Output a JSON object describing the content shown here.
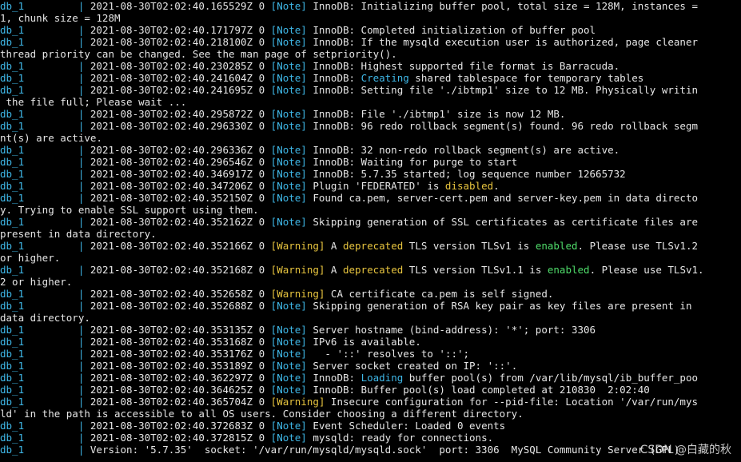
{
  "colors": {
    "background": "#000000",
    "text": "#e6e6e6",
    "service": "#3fb8e8",
    "note": "#3fb8e8",
    "warning": "#e8c53f",
    "highlight_blue": "#3fb8e8",
    "highlight_yellow": "#e8c53f",
    "highlight_green": "#4fdc6a"
  },
  "watermark": "CSDN @白藏的秋",
  "lines": [
    [
      {
        "t": "db_1         | ",
        "c": "svc"
      },
      {
        "t": "2021-08-30T02:02:40.165529Z 0 "
      },
      {
        "t": "[Note]",
        "c": "note"
      },
      {
        "t": " InnoDB: Initializing buffer pool, total size = 128M, instances ="
      }
    ],
    [
      {
        "t": "1, chunk size = 128M"
      }
    ],
    [
      {
        "t": "db_1         | ",
        "c": "svc"
      },
      {
        "t": "2021-08-30T02:02:40.171797Z 0 "
      },
      {
        "t": "[Note]",
        "c": "note"
      },
      {
        "t": " InnoDB: Completed initialization of buffer pool"
      }
    ],
    [
      {
        "t": "db_1         | ",
        "c": "svc"
      },
      {
        "t": "2021-08-30T02:02:40.218100Z 0 "
      },
      {
        "t": "[Note]",
        "c": "note"
      },
      {
        "t": " InnoDB: If the mysqld execution user is authorized, page cleaner"
      }
    ],
    [
      {
        "t": "thread priority can be changed. See the man page of setpriority()."
      }
    ],
    [
      {
        "t": "db_1         | ",
        "c": "svc"
      },
      {
        "t": "2021-08-30T02:02:40.230285Z 0 "
      },
      {
        "t": "[Note]",
        "c": "note"
      },
      {
        "t": " InnoDB: Highest supported file format is Barracuda."
      }
    ],
    [
      {
        "t": "db_1         | ",
        "c": "svc"
      },
      {
        "t": "2021-08-30T02:02:40.241604Z 0 "
      },
      {
        "t": "[Note]",
        "c": "note"
      },
      {
        "t": " InnoDB: "
      },
      {
        "t": "Creating",
        "c": "kw-blue"
      },
      {
        "t": " shared tablespace for temporary tables"
      }
    ],
    [
      {
        "t": "db_1         | ",
        "c": "svc"
      },
      {
        "t": "2021-08-30T02:02:40.241695Z 0 "
      },
      {
        "t": "[Note]",
        "c": "note"
      },
      {
        "t": " InnoDB: Setting file './ibtmp1' size to 12 MB. Physically writin"
      }
    ],
    [
      {
        "t": " the file full; Please wait ..."
      }
    ],
    [
      {
        "t": "db_1         | ",
        "c": "svc"
      },
      {
        "t": "2021-08-30T02:02:40.295872Z 0 "
      },
      {
        "t": "[Note]",
        "c": "note"
      },
      {
        "t": " InnoDB: File './ibtmp1' size is now 12 MB."
      }
    ],
    [
      {
        "t": "db_1         | ",
        "c": "svc"
      },
      {
        "t": "2021-08-30T02:02:40.296330Z 0 "
      },
      {
        "t": "[Note]",
        "c": "note"
      },
      {
        "t": " InnoDB: 96 redo rollback segment(s) found. 96 redo rollback segm"
      }
    ],
    [
      {
        "t": "nt(s) are active."
      }
    ],
    [
      {
        "t": "db_1         | ",
        "c": "svc"
      },
      {
        "t": "2021-08-30T02:02:40.296336Z 0 "
      },
      {
        "t": "[Note]",
        "c": "note"
      },
      {
        "t": " InnoDB: 32 non-redo rollback segment(s) are active."
      }
    ],
    [
      {
        "t": "db_1         | ",
        "c": "svc"
      },
      {
        "t": "2021-08-30T02:02:40.296546Z 0 "
      },
      {
        "t": "[Note]",
        "c": "note"
      },
      {
        "t": " InnoDB: Waiting for purge to start"
      }
    ],
    [
      {
        "t": "db_1         | ",
        "c": "svc"
      },
      {
        "t": "2021-08-30T02:02:40.346917Z 0 "
      },
      {
        "t": "[Note]",
        "c": "note"
      },
      {
        "t": " InnoDB: 5.7.35 started; log sequence number 12665732"
      }
    ],
    [
      {
        "t": "db_1         | ",
        "c": "svc"
      },
      {
        "t": "2021-08-30T02:02:40.347206Z 0 "
      },
      {
        "t": "[Note]",
        "c": "note"
      },
      {
        "t": " Plugin 'FEDERATED' is "
      },
      {
        "t": "disabled",
        "c": "kw-yellow"
      },
      {
        "t": "."
      }
    ],
    [
      {
        "t": "db_1         | ",
        "c": "svc"
      },
      {
        "t": "2021-08-30T02:02:40.352150Z 0 "
      },
      {
        "t": "[Note]",
        "c": "note"
      },
      {
        "t": " Found ca.pem, server-cert.pem and server-key.pem in data directo"
      }
    ],
    [
      {
        "t": "y. Trying to enable SSL support using them."
      }
    ],
    [
      {
        "t": "db_1         | ",
        "c": "svc"
      },
      {
        "t": "2021-08-30T02:02:40.352162Z 0 "
      },
      {
        "t": "[Note]",
        "c": "note"
      },
      {
        "t": " Skipping generation of SSL certificates as certificate files are"
      }
    ],
    [
      {
        "t": "present in data directory."
      }
    ],
    [
      {
        "t": "db_1         | ",
        "c": "svc"
      },
      {
        "t": "2021-08-30T02:02:40.352166Z 0 "
      },
      {
        "t": "[Warning]",
        "c": "warn"
      },
      {
        "t": " A "
      },
      {
        "t": "deprecated",
        "c": "kw-yellow"
      },
      {
        "t": " TLS version TLSv1 is "
      },
      {
        "t": "enabled",
        "c": "kw-green"
      },
      {
        "t": ". Please use TLSv1.2"
      }
    ],
    [
      {
        "t": "or higher."
      }
    ],
    [
      {
        "t": "db_1         | ",
        "c": "svc"
      },
      {
        "t": "2021-08-30T02:02:40.352168Z 0 "
      },
      {
        "t": "[Warning]",
        "c": "warn"
      },
      {
        "t": " A "
      },
      {
        "t": "deprecated",
        "c": "kw-yellow"
      },
      {
        "t": " TLS version TLSv1.1 is "
      },
      {
        "t": "enabled",
        "c": "kw-green"
      },
      {
        "t": ". Please use TLSv1."
      }
    ],
    [
      {
        "t": "2 or higher."
      }
    ],
    [
      {
        "t": "db_1         | ",
        "c": "svc"
      },
      {
        "t": "2021-08-30T02:02:40.352658Z 0 "
      },
      {
        "t": "[Warning]",
        "c": "warn"
      },
      {
        "t": " CA certificate ca.pem is self signed."
      }
    ],
    [
      {
        "t": "db_1         | ",
        "c": "svc"
      },
      {
        "t": "2021-08-30T02:02:40.352688Z 0 "
      },
      {
        "t": "[Note]",
        "c": "note"
      },
      {
        "t": " Skipping generation of RSA key pair as key files are present in"
      }
    ],
    [
      {
        "t": "data directory."
      }
    ],
    [
      {
        "t": "db_1         | ",
        "c": "svc"
      },
      {
        "t": "2021-08-30T02:02:40.353135Z 0 "
      },
      {
        "t": "[Note]",
        "c": "note"
      },
      {
        "t": " Server hostname (bind-address): '*'; port: 3306"
      }
    ],
    [
      {
        "t": "db_1         | ",
        "c": "svc"
      },
      {
        "t": "2021-08-30T02:02:40.353168Z 0 "
      },
      {
        "t": "[Note]",
        "c": "note"
      },
      {
        "t": " IPv6 is available."
      }
    ],
    [
      {
        "t": "db_1         | ",
        "c": "svc"
      },
      {
        "t": "2021-08-30T02:02:40.353176Z 0 "
      },
      {
        "t": "[Note]",
        "c": "note"
      },
      {
        "t": "   - '::' resolves to '::';"
      }
    ],
    [
      {
        "t": "db_1         | ",
        "c": "svc"
      },
      {
        "t": "2021-08-30T02:02:40.353189Z 0 "
      },
      {
        "t": "[Note]",
        "c": "note"
      },
      {
        "t": " Server socket created on IP: '::'."
      }
    ],
    [
      {
        "t": "db_1         | ",
        "c": "svc"
      },
      {
        "t": "2021-08-30T02:02:40.362297Z 0 "
      },
      {
        "t": "[Note]",
        "c": "note"
      },
      {
        "t": " InnoDB: "
      },
      {
        "t": "Loading",
        "c": "kw-blue"
      },
      {
        "t": " buffer pool(s) from /var/lib/mysql/ib_buffer_poo"
      }
    ],
    [
      {
        "t": "db_1         | ",
        "c": "svc"
      },
      {
        "t": "2021-08-30T02:02:40.364625Z 0 "
      },
      {
        "t": "[Note]",
        "c": "note"
      },
      {
        "t": " InnoDB: Buffer pool(s) load completed at 210830  2:02:40"
      }
    ],
    [
      {
        "t": "db_1         | ",
        "c": "svc"
      },
      {
        "t": "2021-08-30T02:02:40.365704Z 0 "
      },
      {
        "t": "[Warning]",
        "c": "warn"
      },
      {
        "t": " Insecure configuration for --pid-file: Location '/var/run/mys"
      }
    ],
    [
      {
        "t": "ld' in the path is accessible to all OS users. Consider choosing a different directory."
      }
    ],
    [
      {
        "t": "db_1         | ",
        "c": "svc"
      },
      {
        "t": "2021-08-30T02:02:40.372683Z 0 "
      },
      {
        "t": "[Note]",
        "c": "note"
      },
      {
        "t": " Event Scheduler: Loaded 0 events"
      }
    ],
    [
      {
        "t": "db_1         | ",
        "c": "svc"
      },
      {
        "t": "2021-08-30T02:02:40.372815Z 0 "
      },
      {
        "t": "[Note]",
        "c": "note"
      },
      {
        "t": " mysqld: ready for connections."
      }
    ],
    [
      {
        "t": "db_1         | ",
        "c": "svc"
      },
      {
        "t": "Version: '5.7.35'  socket: '/var/run/mysqld/mysqld.sock'  port: 3306  MySQL Community Server (GPL)"
      }
    ]
  ]
}
